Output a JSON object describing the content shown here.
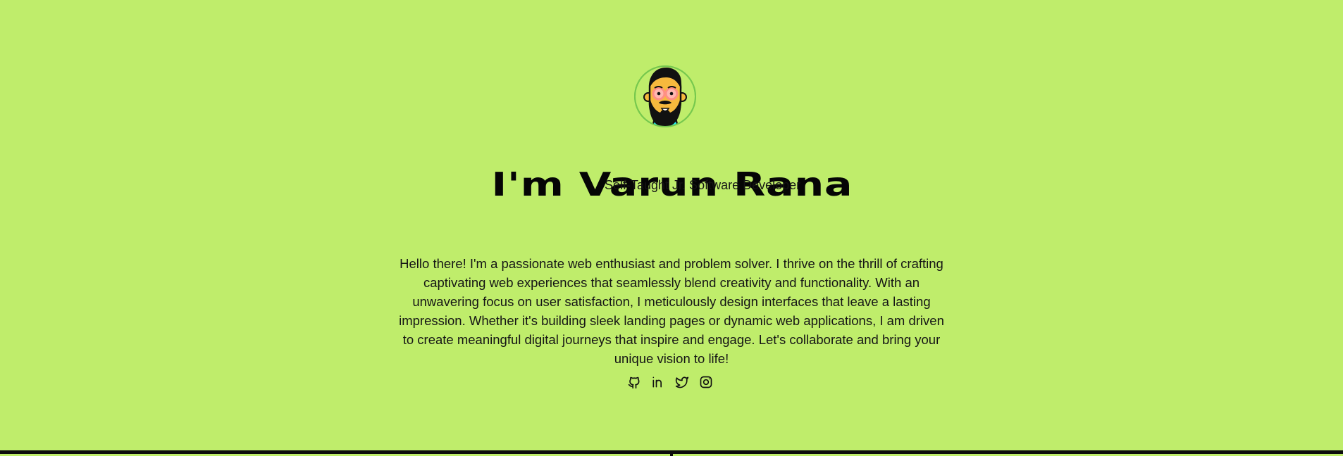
{
  "profile": {
    "title": "I'm Varun Rana",
    "subtitle": "Self-Taught Jr. Software Developer",
    "avatar_alt": "Varun Rana avatar"
  },
  "about": {
    "text": "Hello there! I'm a passionate web enthusiast and problem solver. I thrive on the thrill of crafting captivating web experiences that seamlessly blend creativity and functionality. With an unwavering focus on user satisfaction, I meticulously design interfaces that leave a lasting impression. Whether it's building sleek landing pages or dynamic web applications, I am driven to create meaningful digital journeys that inspire and engage. Let's collaborate and bring your unique vision to life!"
  },
  "social_links": [
    {
      "icon": "github-icon"
    },
    {
      "icon": "linkedin-icon"
    },
    {
      "icon": "twitter-icon"
    },
    {
      "icon": "instagram-icon"
    }
  ],
  "colors": {
    "background": "#bfed6b",
    "text": "#111111",
    "avatar_ring": "#76c84e",
    "avatar_skin": "#f6b93d",
    "avatar_beard": "#111111",
    "avatar_shirt": "#28f0ef",
    "glasses": "#ff8f84"
  }
}
